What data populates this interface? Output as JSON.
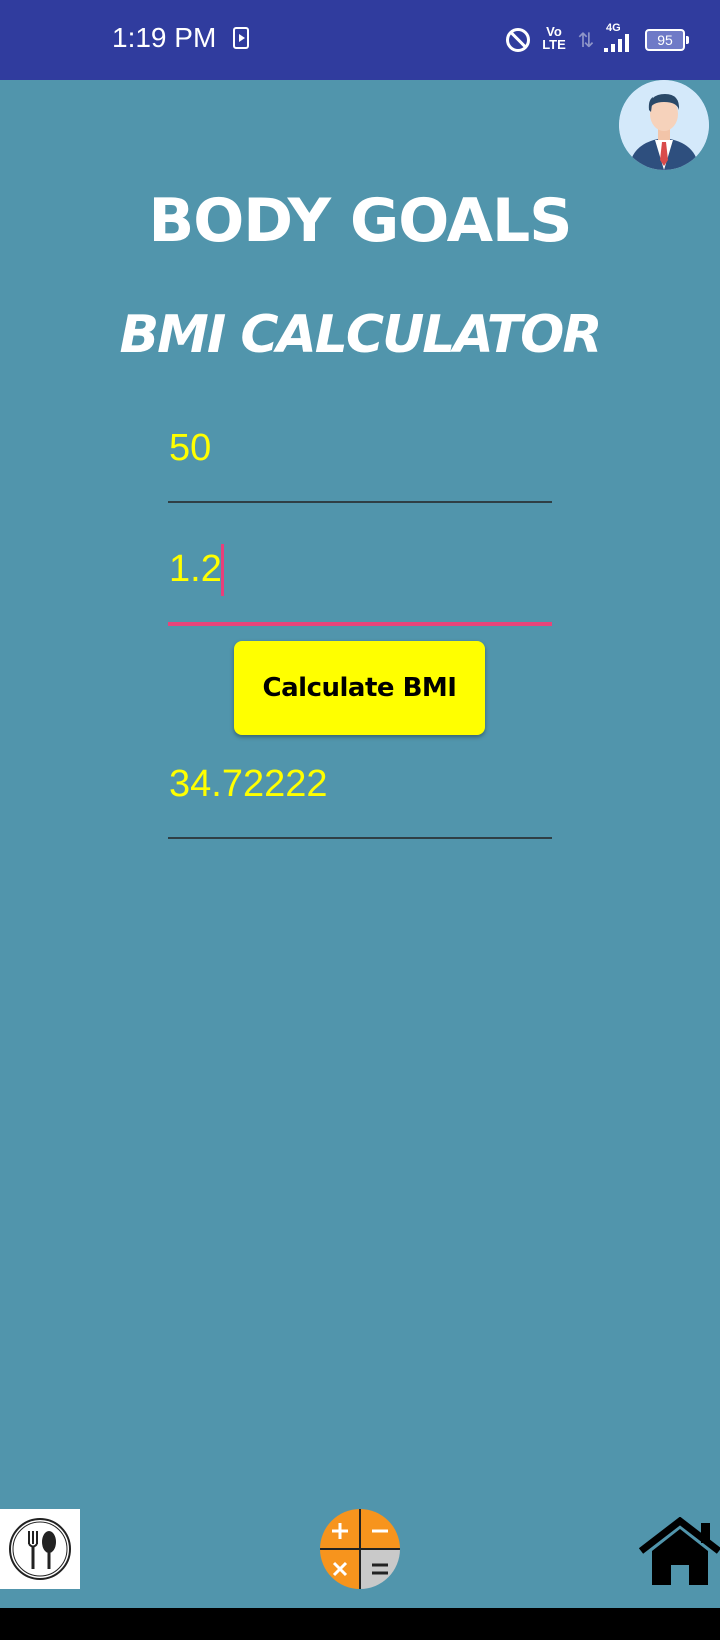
{
  "status_bar": {
    "time": "1:19 PM",
    "volte_top": "Vo",
    "volte_bottom": "LTE",
    "network": "4G",
    "battery": "95"
  },
  "header": {
    "title": "BODY GOALS",
    "subtitle": "BMI CALCULATOR"
  },
  "form": {
    "weight_value": "50",
    "height_value": "1.2",
    "button_label": "Calculate BMI",
    "result_value": "34.72222"
  },
  "colors": {
    "background": "#5195ac",
    "status_bar": "#303c9e",
    "accent_yellow": "#ffff00",
    "focus_pink": "#e8447a"
  },
  "icons": {
    "avatar": "businessman-avatar-icon",
    "diet": "fork-spoon-icon",
    "calculator": "calculator-icon",
    "home": "home-icon"
  }
}
